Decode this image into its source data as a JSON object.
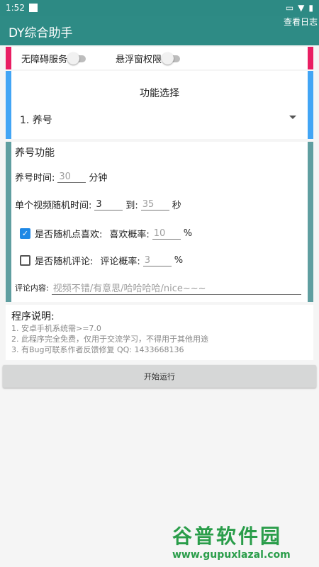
{
  "status": {
    "time": "1:52"
  },
  "appbar": {
    "title": "DY综合助手",
    "log_label": "查看日志"
  },
  "permissions": {
    "accessibility_label": "无障碍服务",
    "overlay_label": "悬浮窗权限"
  },
  "function_select": {
    "title": "功能选择",
    "selected": "1. 养号"
  },
  "yanghao": {
    "title": "养号功能",
    "time_label": "养号时间:",
    "time_value": "30",
    "time_unit": "分钟",
    "video_label": "单个视频随机时间:",
    "video_from": "3",
    "video_to_label": "到:",
    "video_to": "35",
    "video_unit": "秒",
    "like_label": "是否随机点喜欢:",
    "like_rate_label": "喜欢概率:",
    "like_rate": "10",
    "like_unit": "%",
    "comment_label": "是否随机评论:",
    "comment_rate_label": "评论概率:",
    "comment_rate": "3",
    "comment_unit": "%",
    "content_label": "评论内容:",
    "content_placeholder": "视频不错/有意思/哈哈哈哈/nice~~~"
  },
  "description": {
    "title": "程序说明:",
    "lines": [
      "1. 安卓手机系统需>=7.0",
      "2. 此程序完全免费，仅用于交流学习，不得用于其他用途",
      "3. 有Bug可联系作者反馈修复 QQ: 1433668136"
    ]
  },
  "start_button": "开始运行",
  "watermark": {
    "text1": "谷普软件园",
    "text2": "www.gupuxlazal.com"
  }
}
